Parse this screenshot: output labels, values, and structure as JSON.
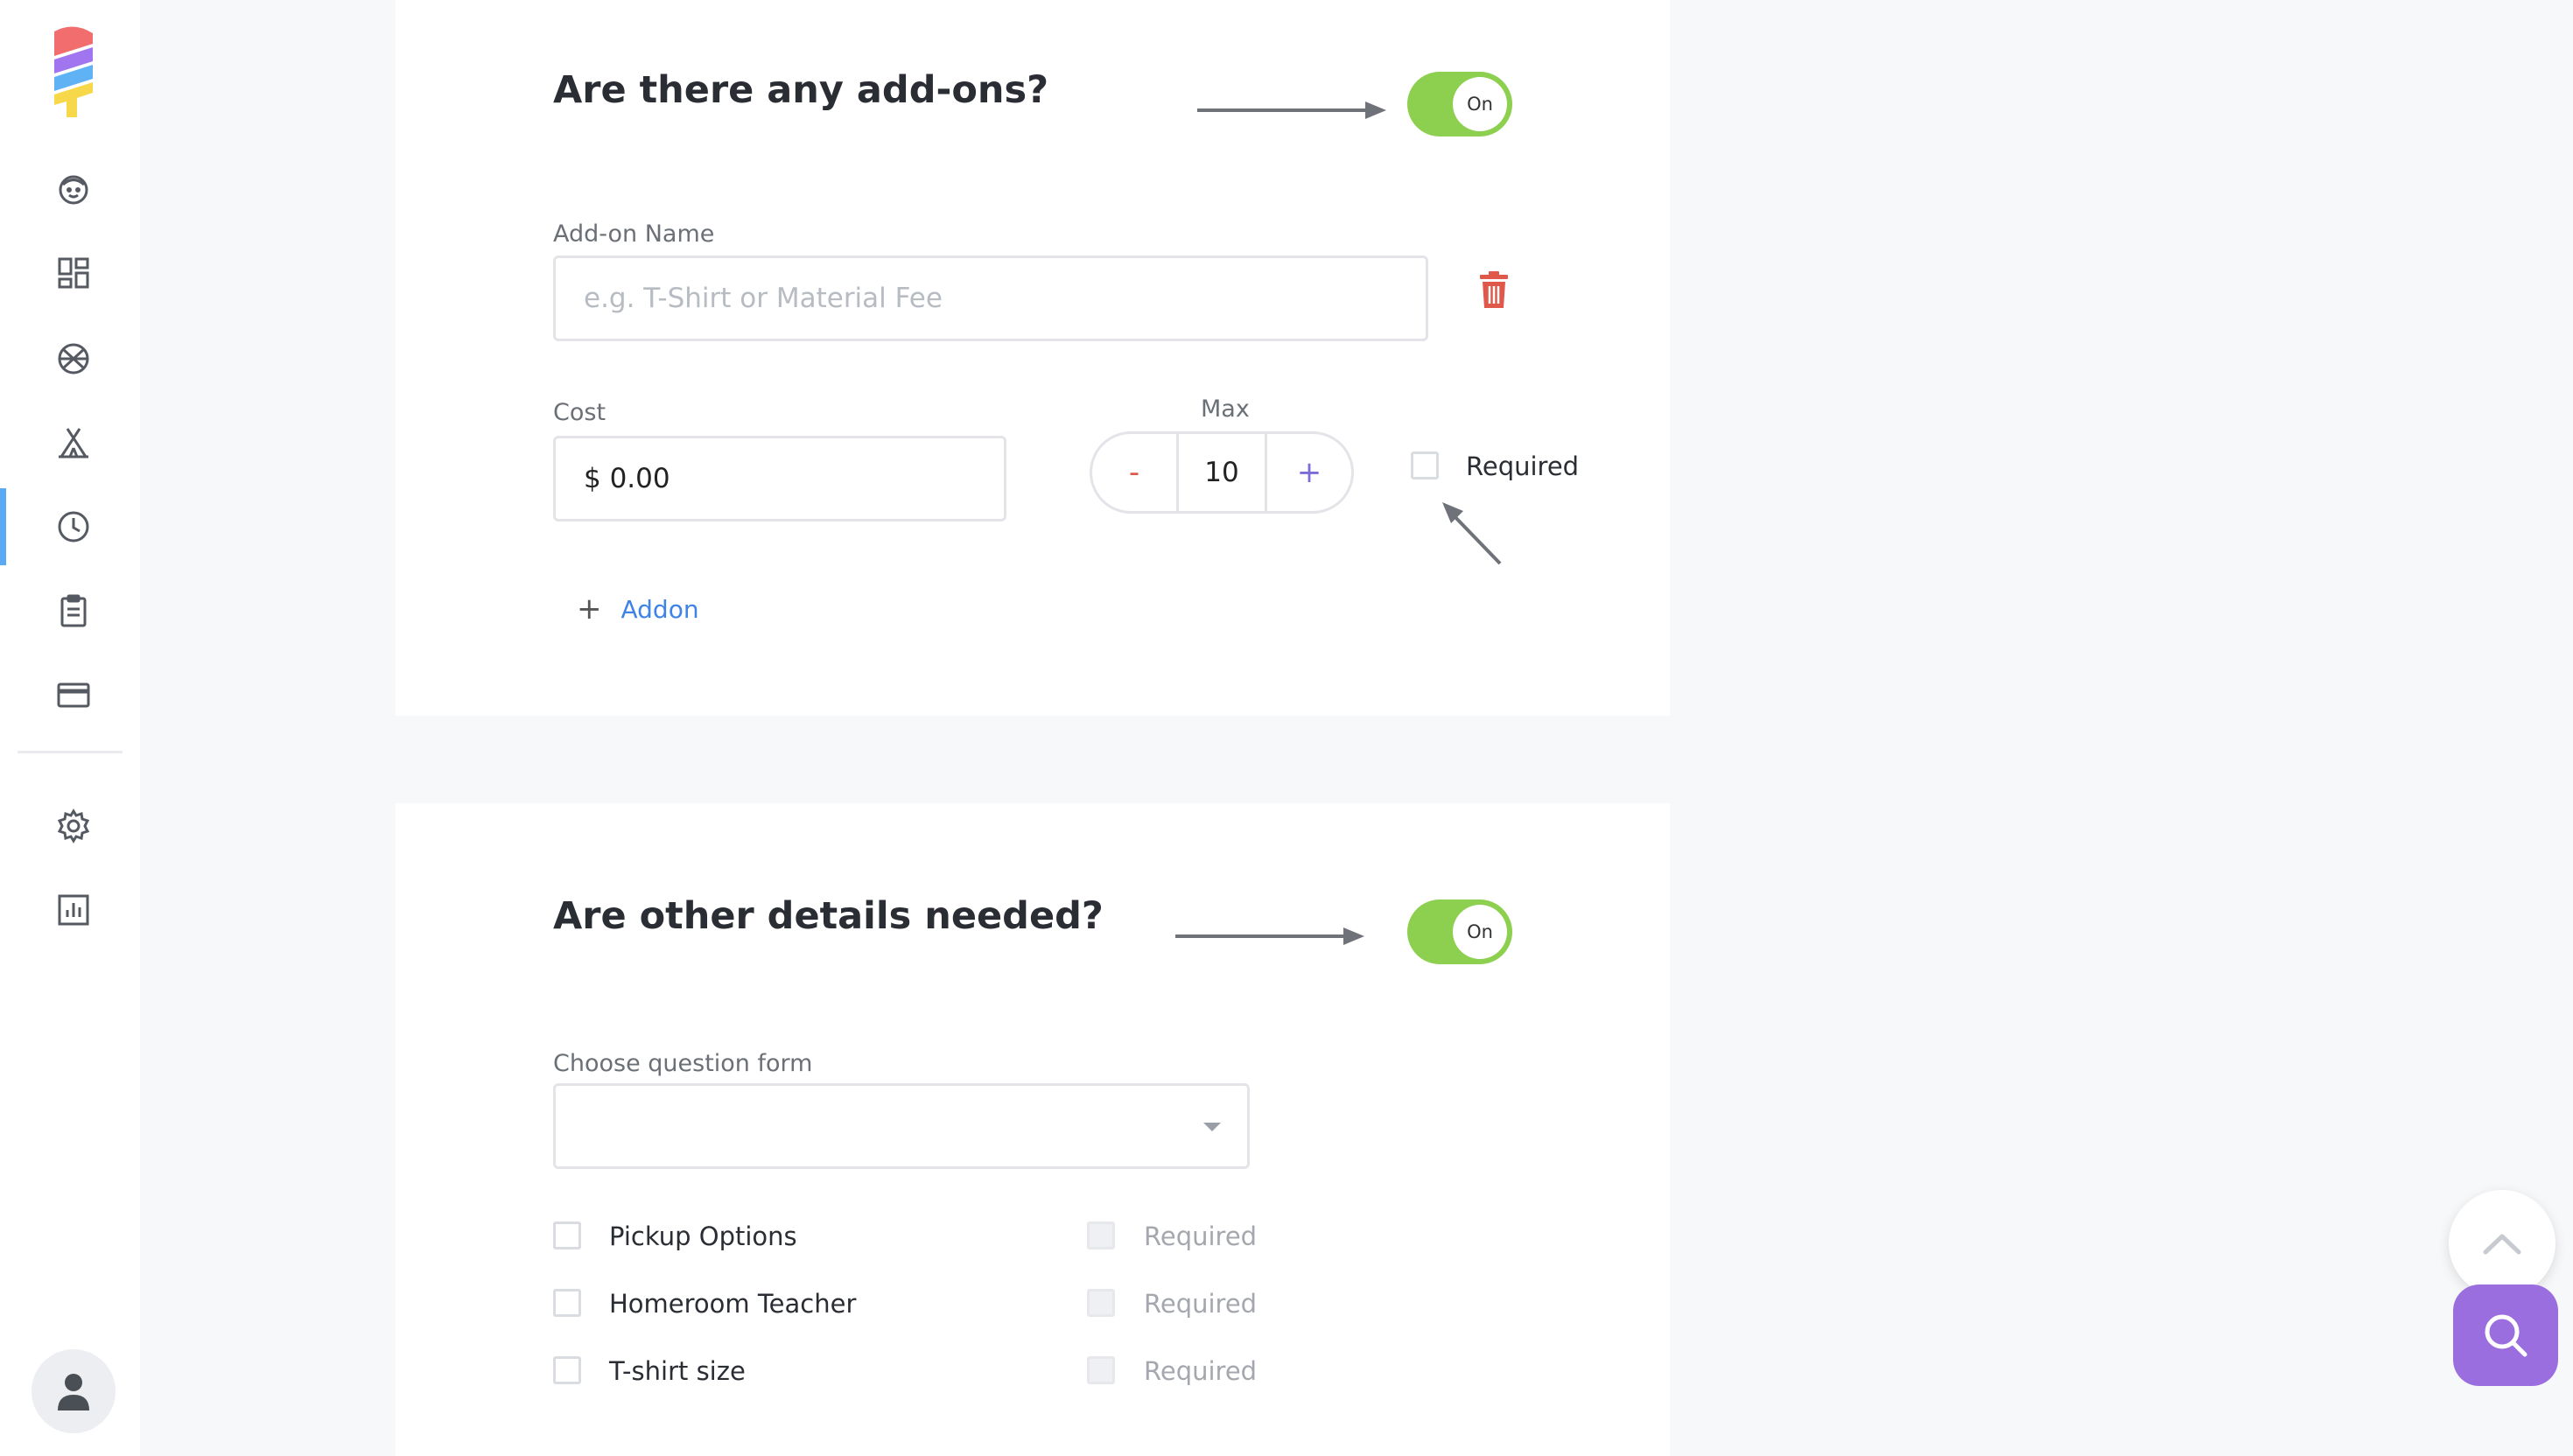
{
  "sidebar": {
    "nav_items": [
      {
        "icon": "face-icon"
      },
      {
        "icon": "dashboard-icon"
      },
      {
        "icon": "basketball-icon"
      },
      {
        "icon": "camp-tent-icon"
      },
      {
        "icon": "clock-icon",
        "active": true
      },
      {
        "icon": "clipboard-icon"
      },
      {
        "icon": "credit-card-icon"
      },
      {
        "icon": "gear-icon"
      },
      {
        "icon": "bar-chart-icon"
      }
    ],
    "avatar_icon": "user-icon",
    "active_color": "#5aa9f5"
  },
  "addons_section": {
    "title": "Are there any add-ons?",
    "toggle_label": "On",
    "toggle_on": true,
    "addon_name_label": "Add-on Name",
    "addon_name_placeholder": "e.g. T-Shirt or Material Fee",
    "addon_name_value": "",
    "cost_label": "Cost",
    "cost_value": "$ 0.00",
    "max_label": "Max",
    "max_minus": "-",
    "max_value": "10",
    "max_plus": "+",
    "required_label": "Required",
    "required_checked": false,
    "add_button_plus": "+",
    "add_button_label": "Addon"
  },
  "details_section": {
    "title": "Are other details needed?",
    "toggle_label": "On",
    "toggle_on": true,
    "question_form_label": "Choose question form",
    "question_form_value": "",
    "questions": [
      {
        "label": "Pickup Options",
        "checked": false,
        "required_label": "Required"
      },
      {
        "label": "Homeroom Teacher",
        "checked": false,
        "required_label": "Required"
      },
      {
        "label": "T-shirt size",
        "checked": false,
        "required_label": "Required"
      }
    ]
  },
  "floating": {
    "scroll_top_icon": "chevron-up-icon",
    "search_icon": "search-icon"
  },
  "colors": {
    "toggle_on": "#8dcf4f",
    "link": "#3f83e6",
    "danger": "#e0584a",
    "accent_purple": "#9b6ee0",
    "page_bg": "#f7f8fa"
  }
}
